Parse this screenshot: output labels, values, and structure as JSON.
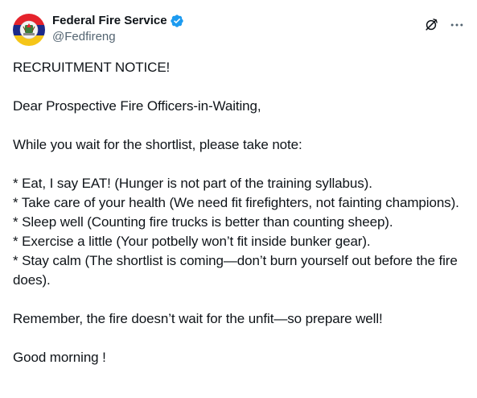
{
  "author": {
    "display_name": "Federal Fire Service",
    "handle": "@Fedfireng",
    "verified_icon": "verified-badge-icon",
    "avatar_colors": {
      "top": "#e5232c",
      "middle": "#1c2a8a",
      "bottom": "#f5c518",
      "emblem": "#f3f3f3"
    }
  },
  "toolbar": {
    "grok_icon": "grok-icon",
    "more_icon": "more-horizontal-icon"
  },
  "colors": {
    "text": "#0f1419",
    "secondary": "#536471",
    "verified": "#1d9bf0"
  },
  "post": {
    "title": "RECRUITMENT NOTICE!",
    "greeting": "Dear Prospective Fire Officers-in-Waiting,",
    "intro": "While you wait for the shortlist, please take note:",
    "tips": [
      "* Eat, I say EAT! (Hunger is not part of the training syllabus).",
      "* Take care of your health (We need fit firefighters, not fainting champions).",
      "* Sleep well (Counting fire trucks is better than counting sheep).",
      "* Exercise a little (Your potbelly won’t fit inside bunker gear).",
      "* Stay calm (The shortlist is coming—don’t burn yourself out before the fire does)."
    ],
    "closing": "Remember, the fire doesn’t wait for the unfit—so prepare well!",
    "signoff": "Good morning !"
  }
}
